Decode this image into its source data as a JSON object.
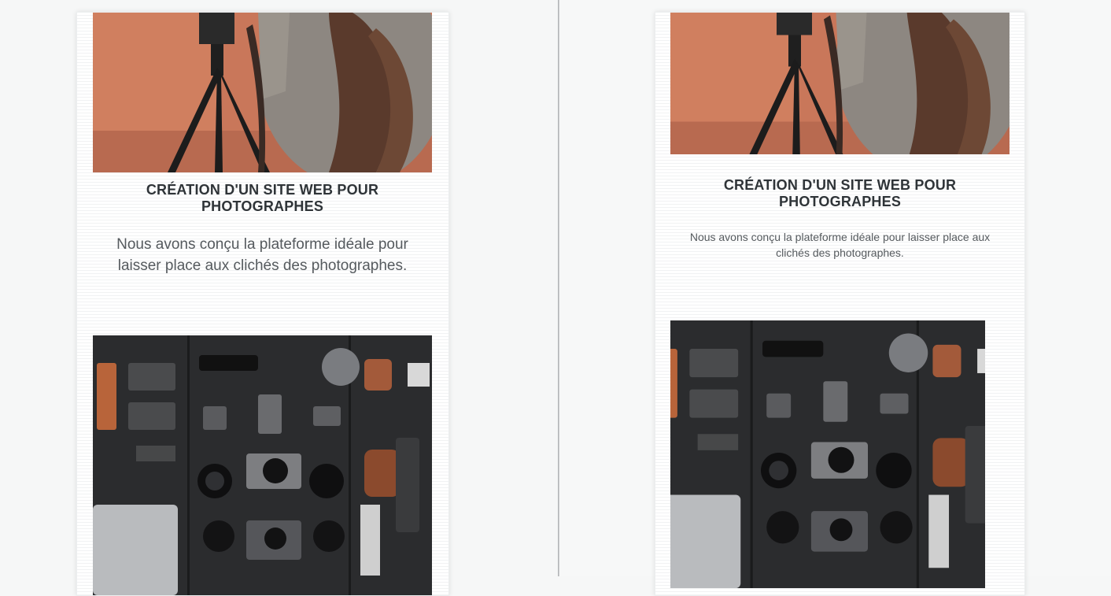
{
  "panels": {
    "left": {
      "card": {
        "image_alt": "photographer-with-tripod",
        "title": "CRÉATION D'UN SITE WEB POUR PHOTOGRAPHES",
        "description": "Nous avons conçu la plateforme idéale pour laisser place aux clichés des photographes.",
        "next_image_alt": "camera-gear-flatlay"
      }
    },
    "right": {
      "card": {
        "image_alt": "photographer-with-tripod",
        "title": "CRÉATION D'UN SITE WEB POUR PHOTOGRAPHES",
        "description": "Nous avons conçu la plateforme idéale pour laisser place aux clichés des photographes.",
        "next_image_alt": "camera-gear-flatlay"
      }
    }
  },
  "colors": {
    "page_background": "#f6f7f7",
    "card_background": "#ffffff",
    "title_text": "#2f3438",
    "body_text": "#555a5e"
  }
}
